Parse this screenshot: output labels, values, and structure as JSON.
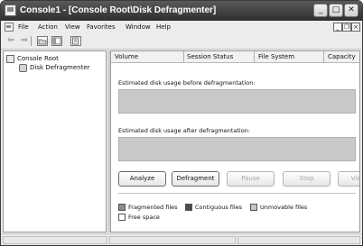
{
  "window": {
    "title": "Console1 - [Console Root\\Disk Defragmenter]",
    "controls": {
      "minimize": "_",
      "maximize": "□",
      "close": "✕"
    }
  },
  "menubar": {
    "items": [
      "File",
      "Action",
      "View",
      "Favorites",
      "Window",
      "Help"
    ],
    "mdi_controls": {
      "minimize": "_",
      "restore": "❐",
      "close": "×"
    }
  },
  "toolbar": {
    "back": "⇦",
    "forward": "⇨"
  },
  "tree": {
    "root": "Console Root",
    "child": "Disk Defragmenter"
  },
  "columns": [
    "Volume",
    "Session Status",
    "File System",
    "Capacity"
  ],
  "estimates": {
    "before": "Estimated disk usage before defragmentation:",
    "after": "Estimated disk usage after defragmentation:"
  },
  "buttons": {
    "analyze": "Analyze",
    "defragment": "Defragment",
    "pause": "Pause",
    "stop": "Stop",
    "view_report": "View R"
  },
  "legend": {
    "fragmented": "Fragmented files",
    "contiguous": "Contiguous files",
    "unmovable": "Unmovable files",
    "free": "Free space"
  },
  "colors": {
    "fragmented": "#8c8c8c",
    "contiguous": "#4a4a4a",
    "unmovable": "#c4c4c4",
    "free": "#ffffff",
    "usage_bar": "#c9c9c9",
    "titlebar": "#3c3c3c"
  }
}
